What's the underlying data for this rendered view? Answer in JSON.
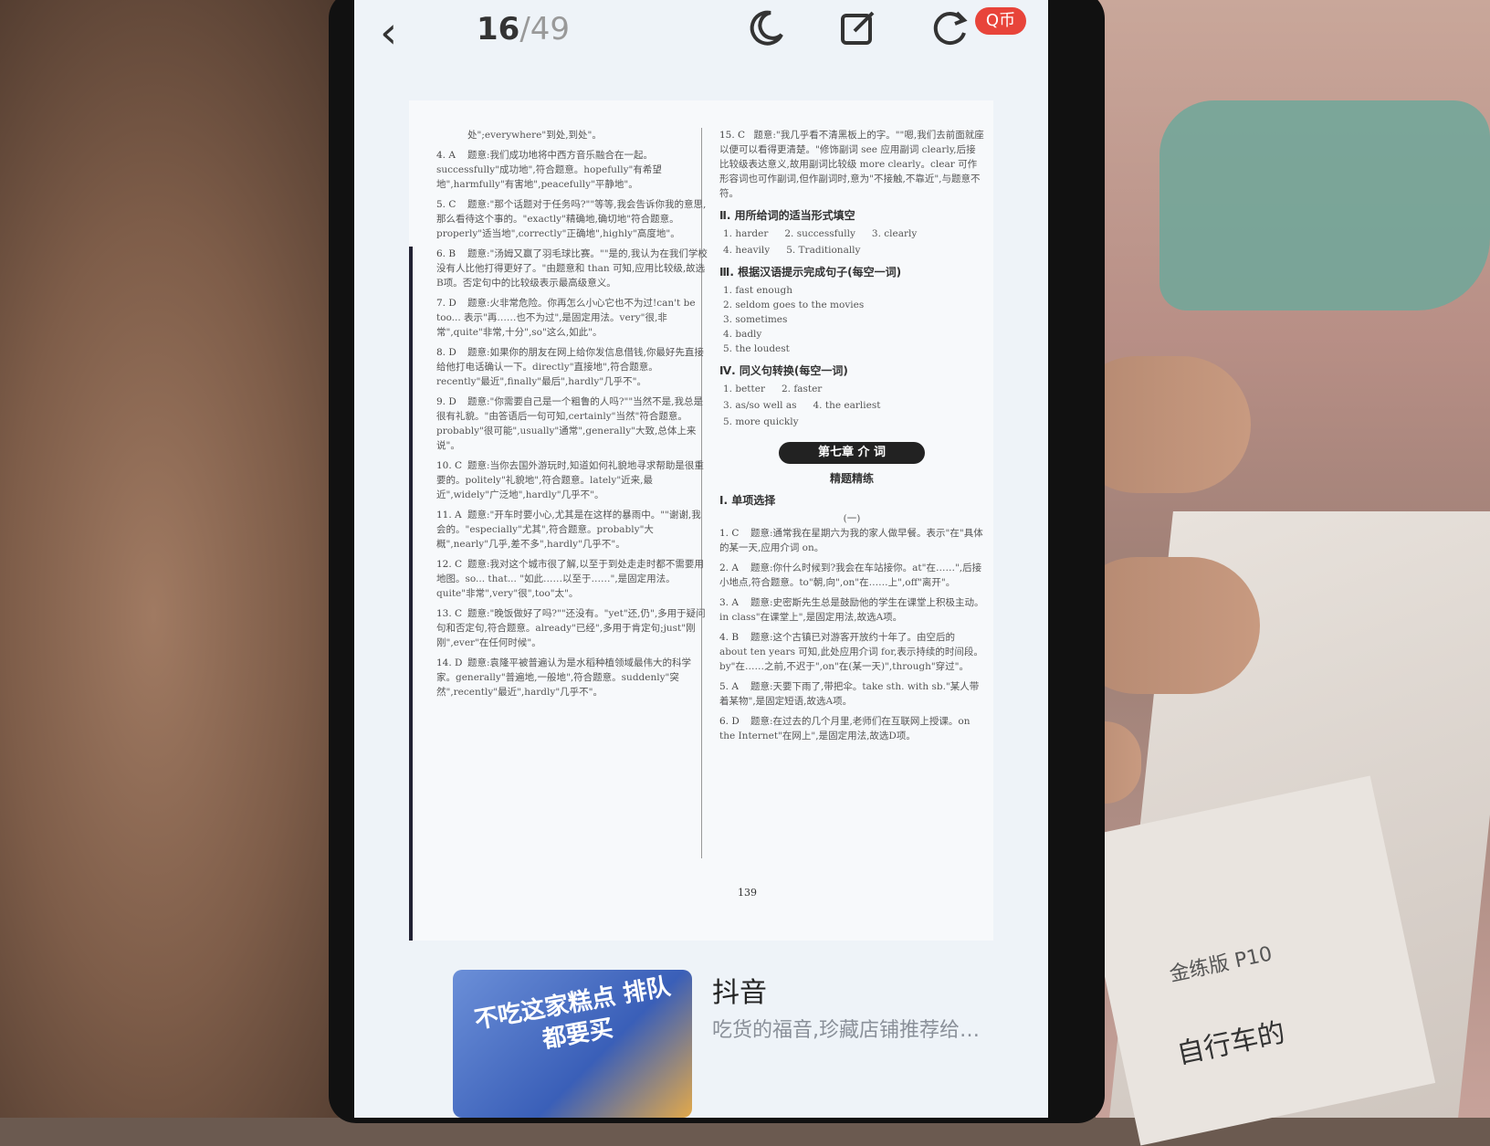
{
  "viewer": {
    "current_page": "16",
    "total_pages": "/49",
    "back_icon": "‹",
    "badge": "Q币"
  },
  "doc": {
    "left_items": [
      {
        "num": "",
        "text": "处\";everywhere\"到处,到处\"。"
      },
      {
        "num": "4. A",
        "text": "题意:我们成功地将中西方音乐融合在一起。successfully\"成功地\",符合题意。hopefully\"有希望地\",harmfully\"有害地\",peacefully\"平静地\"。"
      },
      {
        "num": "5. C",
        "text": "题意:\"那个话题对于任务吗?\"\"等等,我会告诉你我的意思,那么看待这个事的。\"exactly\"精确地,确切地\"符合题意。properly\"适当地\",correctly\"正确地\",highly\"高度地\"。"
      },
      {
        "num": "6. B",
        "text": "题意:\"汤姆又赢了羽毛球比赛。\"\"是的,我认为在我们学校没有人比他打得更好了。\"由题意和 than 可知,应用比较级,故选B项。否定句中的比较级表示最高级意义。"
      },
      {
        "num": "7. D",
        "text": "题意:火非常危险。你再怎么小心它也不为过!can't be too... 表示\"再……也不为过\",是固定用法。very\"很,非常\",quite\"非常,十分\",so\"这么,如此\"。"
      },
      {
        "num": "8. D",
        "text": "题意:如果你的朋友在网上给你发信息借钱,你最好先直接给他打电话确认一下。directly\"直接地\",符合题意。recently\"最近\",finally\"最后\",hardly\"几乎不\"。"
      },
      {
        "num": "9. D",
        "text": "题意:\"你需要自己是一个粗鲁的人吗?\"\"当然不是,我总是很有礼貌。\"由答语后一句可知,certainly\"当然\"符合题意。probably\"很可能\",usually\"通常\",generally\"大致,总体上来说\"。"
      },
      {
        "num": "10. C",
        "text": "题意:当你去国外游玩时,知道如何礼貌地寻求帮助是很重要的。politely\"礼貌地\",符合题意。lately\"近来,最近\",widely\"广泛地\",hardly\"几乎不\"。"
      },
      {
        "num": "11. A",
        "text": "题意:\"开车时要小心,尤其是在这样的暴雨中。\"\"谢谢,我会的。\"especially\"尤其\",符合题意。probably\"大概\",nearly\"几乎,差不多\",hardly\"几乎不\"。"
      },
      {
        "num": "12. C",
        "text": "题意:我对这个城市很了解,以至于到处走走时都不需要用地图。so... that... \"如此……以至于……\",是固定用法。quite\"非常\",very\"很\",too\"太\"。"
      },
      {
        "num": "13. C",
        "text": "题意:\"晚饭做好了吗?\"\"还没有。\"yet\"还,仍\",多用于疑问句和否定句,符合题意。already\"已经\",多用于肯定句;just\"刚刚\",ever\"在任何时候\"。"
      },
      {
        "num": "14. D",
        "text": "题意:袁隆平被普遍认为是水稻种植领域最伟大的科学家。generally\"普遍地,一般地\",符合题意。suddenly\"突然\",recently\"最近\",hardly\"几乎不\"。"
      }
    ],
    "right_top_item": {
      "num": "15. C",
      "text": "题意:\"我几乎看不清黑板上的字。\"\"嗯,我们去前面就座以便可以看得更清楚。\"修饰副词 see 应用副词 clearly,后接比较级表达意义,故用副词比较级 more clearly。clear 可作形容词也可作副词,但作副词时,意为\"不接触,不靠近\",与题意不符。"
    },
    "sec2_title": "Ⅱ. 用所给词的适当形式填空",
    "sec2_rows": [
      [
        "1. harder",
        "2. successfully",
        "3. clearly"
      ],
      [
        "4. heavily",
        "5. Traditionally",
        ""
      ]
    ],
    "sec3_title": "Ⅲ. 根据汉语提示完成句子(每空一词)",
    "sec3_items": [
      "1. fast enough",
      "2. seldom goes to the movies",
      "3. sometimes",
      "4. badly",
      "5. the loudest"
    ],
    "sec4_title": "Ⅳ. 同义句转换(每空一词)",
    "sec4_rows": [
      [
        "1. better",
        "2. faster"
      ],
      [
        "3. as/so well as",
        "4. the earliest"
      ],
      [
        "5. more quickly",
        ""
      ]
    ],
    "chapter_title": "第七章 介 词",
    "practice_title": "精题精练",
    "sec1_title": "Ⅰ. 单项选择",
    "sec1_sub": "(一)",
    "sec1_items": [
      {
        "num": "1. C",
        "text": "题意:通常我在星期六为我的家人做早餐。表示\"在\"具体的某一天,应用介词 on。"
      },
      {
        "num": "2. A",
        "text": "题意:你什么时候到?我会在车站接你。at\"在……\",后接小地点,符合题意。to\"朝,向\",on\"在……上\",off\"离开\"。"
      },
      {
        "num": "3. A",
        "text": "题意:史密斯先生总是鼓励他的学生在课堂上积极主动。in class\"在课堂上\",是固定用法,故选A项。"
      },
      {
        "num": "4. B",
        "text": "题意:这个古镇已对游客开放约十年了。由空后的 about ten years 可知,此处应用介词 for,表示持续的时间段。by\"在……之前,不迟于\",on\"在(某一天)\",through\"穿过\"。"
      },
      {
        "num": "5. A",
        "text": "题意:天要下雨了,带把伞。take sth. with sb.\"某人带着某物\",是固定短语,故选A项。"
      },
      {
        "num": "6. D",
        "text": "题意:在过去的几个月里,老师们在互联网上授课。on the Internet\"在网上\",是固定用法,故选D项。"
      }
    ],
    "page_number": "139"
  },
  "ad": {
    "image_text": "不吃这家糕点 排队都要买",
    "title": "抖音",
    "subtitle": "吃货的福音,珍藏店铺推荐给…"
  },
  "background": {
    "booklet_label": "金练版 P10",
    "booklet_text": "自行车的"
  },
  "colors": {
    "badge": "#e8443a",
    "chapter_bg": "#222222",
    "screen_bg": "#eef3f8"
  }
}
